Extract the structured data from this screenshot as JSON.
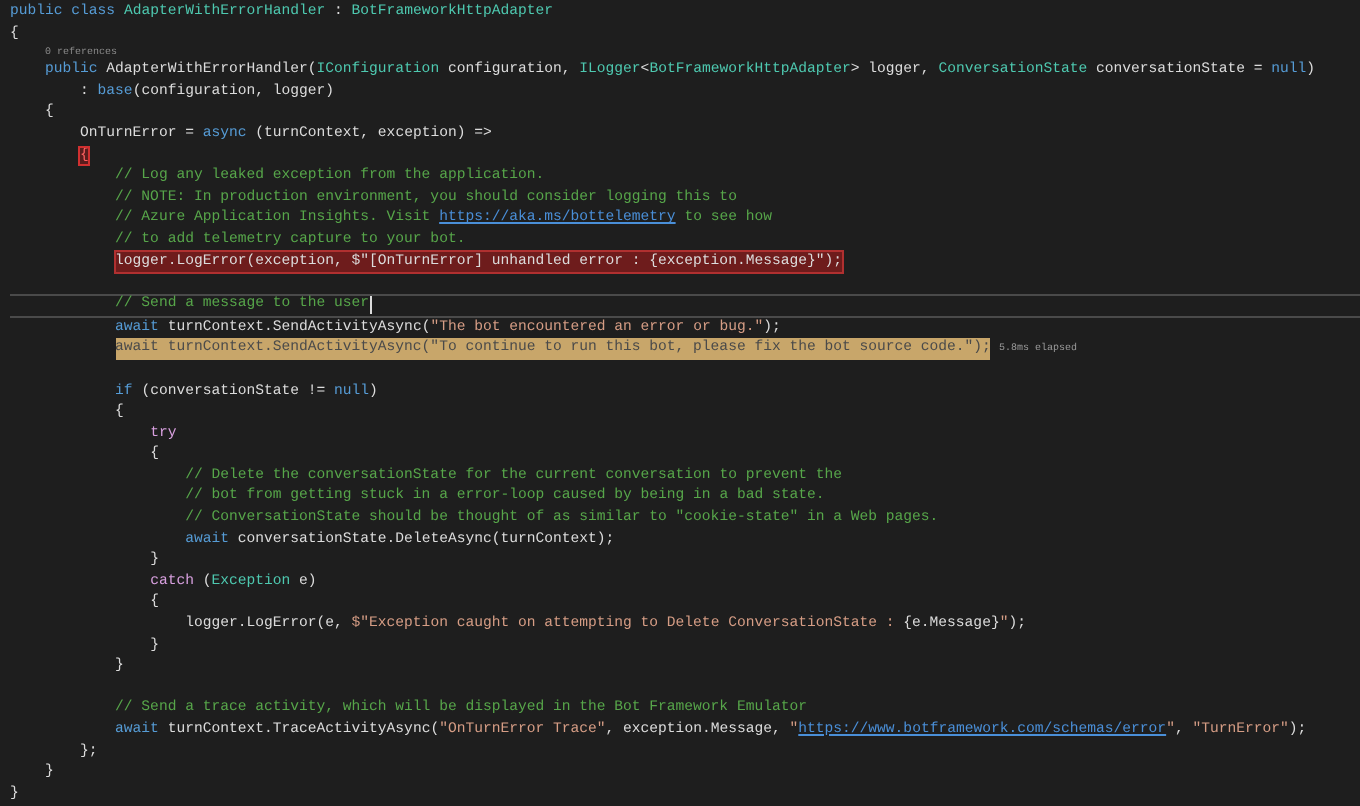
{
  "lines": [
    {
      "kind": "code",
      "segments": [
        {
          "text": "public class ",
          "kind": "keyword"
        },
        {
          "text": "AdapterWithErrorHandler",
          "kind": "type"
        },
        {
          "text": " : ",
          "kind": "plain"
        },
        {
          "text": "BotFrameworkHttpAdapter",
          "kind": "type"
        }
      ]
    },
    {
      "kind": "code",
      "segments": [
        {
          "text": "{",
          "kind": "plain"
        }
      ]
    },
    {
      "kind": "codelens",
      "text": "    0 references"
    },
    {
      "kind": "code",
      "segments": [
        {
          "text": "    public ",
          "kind": "keyword"
        },
        {
          "text": "AdapterWithErrorHandler(",
          "kind": "plain"
        },
        {
          "text": "IConfiguration",
          "kind": "type"
        },
        {
          "text": " configuration, ",
          "kind": "plain"
        },
        {
          "text": "ILogger",
          "kind": "type"
        },
        {
          "text": "<",
          "kind": "plain"
        },
        {
          "text": "BotFrameworkHttpAdapter",
          "kind": "type"
        },
        {
          "text": "> logger, ",
          "kind": "plain"
        },
        {
          "text": "ConversationState",
          "kind": "type"
        },
        {
          "text": " conversationState = ",
          "kind": "plain"
        },
        {
          "text": "null",
          "kind": "keyword"
        },
        {
          "text": ")",
          "kind": "plain"
        }
      ]
    },
    {
      "kind": "code",
      "segments": [
        {
          "text": "        : ",
          "kind": "plain"
        },
        {
          "text": "base",
          "kind": "keyword"
        },
        {
          "text": "(configuration, logger)",
          "kind": "plain"
        }
      ]
    },
    {
      "kind": "code",
      "segments": [
        {
          "text": "    {",
          "kind": "plain"
        }
      ]
    },
    {
      "kind": "code",
      "segments": [
        {
          "text": "        OnTurnError = ",
          "kind": "plain"
        },
        {
          "text": "async",
          "kind": "keyword"
        },
        {
          "text": " (turnContext, exception) =>",
          "kind": "plain"
        }
      ]
    },
    {
      "kind": "code",
      "segments": [
        {
          "text": "        {",
          "kind": "brace-error"
        }
      ]
    },
    {
      "kind": "code",
      "segments": [
        {
          "text": "            // Log any leaked exception from the application.",
          "kind": "comment"
        }
      ]
    },
    {
      "kind": "code",
      "segments": [
        {
          "text": "            // NOTE: In production environment, you should consider logging this to",
          "kind": "comment"
        }
      ]
    },
    {
      "kind": "code",
      "segments": [
        {
          "text": "            // Azure Application Insights. Visit ",
          "kind": "comment"
        },
        {
          "text": "https://aka.ms/bottelemetry",
          "kind": "link"
        },
        {
          "text": " to see how",
          "kind": "comment"
        }
      ]
    },
    {
      "kind": "code",
      "segments": [
        {
          "text": "            // to add telemetry capture to your bot.",
          "kind": "comment"
        }
      ]
    },
    {
      "kind": "code",
      "error": true,
      "segments": [
        {
          "text": "            logger.LogError(exception, $\"[OnTurnError] unhandled error : {exception.Message}\");",
          "kind": "plain"
        }
      ]
    },
    {
      "kind": "blank"
    },
    {
      "kind": "code",
      "current": true,
      "caret": true,
      "segments": [
        {
          "text": "            // Send a message to the user",
          "kind": "comment"
        }
      ]
    },
    {
      "kind": "code",
      "segments": [
        {
          "text": "            await",
          "kind": "keyword"
        },
        {
          "text": " turnContext.SendActivityAsync(",
          "kind": "plain"
        },
        {
          "text": "\"The bot encountered an error or bug.\"",
          "kind": "string"
        },
        {
          "text": ");",
          "kind": "plain"
        }
      ]
    },
    {
      "kind": "code",
      "warning": true,
      "annotation": "5.8ms elapsed",
      "segments": [
        {
          "text": "            await turnContext.SendActivityAsync(\"To continue to run this bot, please fix the bot source code.\");",
          "kind": "plain"
        }
      ]
    },
    {
      "kind": "blank"
    },
    {
      "kind": "code",
      "segments": [
        {
          "text": "            if",
          "kind": "keyword"
        },
        {
          "text": " (conversationState != ",
          "kind": "plain"
        },
        {
          "text": "null",
          "kind": "keyword"
        },
        {
          "text": ")",
          "kind": "plain"
        }
      ]
    },
    {
      "kind": "code",
      "segments": [
        {
          "text": "            {",
          "kind": "plain"
        }
      ]
    },
    {
      "kind": "code",
      "segments": [
        {
          "text": "                try",
          "kind": "control"
        }
      ]
    },
    {
      "kind": "code",
      "segments": [
        {
          "text": "                {",
          "kind": "plain"
        }
      ]
    },
    {
      "kind": "code",
      "segments": [
        {
          "text": "                    // Delete the conversationState for the current conversation to prevent the",
          "kind": "comment"
        }
      ]
    },
    {
      "kind": "code",
      "segments": [
        {
          "text": "                    // bot from getting stuck in a error-loop caused by being in a bad state.",
          "kind": "comment"
        }
      ]
    },
    {
      "kind": "code",
      "segments": [
        {
          "text": "                    // ConversationState should be thought of as similar to \"cookie-state\" in a Web pages.",
          "kind": "comment"
        }
      ]
    },
    {
      "kind": "code",
      "segments": [
        {
          "text": "                    await",
          "kind": "keyword"
        },
        {
          "text": " conversationState.DeleteAsync(turnContext);",
          "kind": "plain"
        }
      ]
    },
    {
      "kind": "code",
      "segments": [
        {
          "text": "                }",
          "kind": "plain"
        }
      ]
    },
    {
      "kind": "code",
      "segments": [
        {
          "text": "                catch",
          "kind": "control"
        },
        {
          "text": " (",
          "kind": "plain"
        },
        {
          "text": "Exception",
          "kind": "type"
        },
        {
          "text": " e)",
          "kind": "plain"
        }
      ]
    },
    {
      "kind": "code",
      "segments": [
        {
          "text": "                {",
          "kind": "plain"
        }
      ]
    },
    {
      "kind": "code",
      "segments": [
        {
          "text": "                    logger.LogError(e, ",
          "kind": "plain"
        },
        {
          "text": "$\"Exception caught on attempting to Delete ConversationState : ",
          "kind": "string"
        },
        {
          "text": "{e.Message}",
          "kind": "plain"
        },
        {
          "text": "\"",
          "kind": "string"
        },
        {
          "text": ");",
          "kind": "plain"
        }
      ]
    },
    {
      "kind": "code",
      "segments": [
        {
          "text": "                }",
          "kind": "plain"
        }
      ]
    },
    {
      "kind": "code",
      "segments": [
        {
          "text": "            }",
          "kind": "plain"
        }
      ]
    },
    {
      "kind": "blank"
    },
    {
      "kind": "code",
      "segments": [
        {
          "text": "            // Send a trace activity, which will be displayed in the Bot Framework Emulator",
          "kind": "comment"
        }
      ]
    },
    {
      "kind": "code",
      "segments": [
        {
          "text": "            await",
          "kind": "keyword"
        },
        {
          "text": " turnContext.TraceActivityAsync(",
          "kind": "plain"
        },
        {
          "text": "\"OnTurnError Trace\"",
          "kind": "string"
        },
        {
          "text": ", exception.Message, ",
          "kind": "plain"
        },
        {
          "text": "\"",
          "kind": "string"
        },
        {
          "text": "https://www.botframework.com/schemas/error",
          "kind": "link"
        },
        {
          "text": "\"",
          "kind": "string"
        },
        {
          "text": ", ",
          "kind": "plain"
        },
        {
          "text": "\"TurnError\"",
          "kind": "string"
        },
        {
          "text": ");",
          "kind": "plain"
        }
      ]
    },
    {
      "kind": "code",
      "segments": [
        {
          "text": "        };",
          "kind": "plain"
        }
      ]
    },
    {
      "kind": "code",
      "segments": [
        {
          "text": "    }",
          "kind": "plain"
        }
      ]
    },
    {
      "kind": "code",
      "segments": [
        {
          "text": "}",
          "kind": "plain"
        }
      ]
    }
  ]
}
